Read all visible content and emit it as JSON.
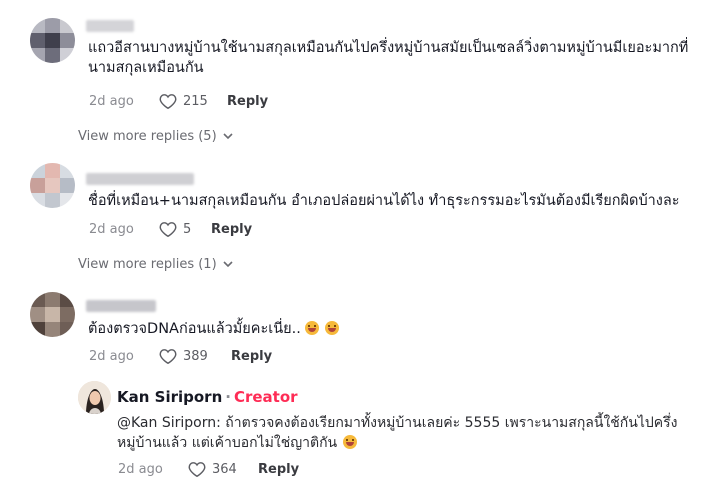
{
  "comments": [
    {
      "text_lines": [
        "แถวอีสานบางหมู่บ้านใช้นามสกุลเหมือนกันไปครึ่งหมู่บ้านสมัยเป็นเซลล์วิ่งตามหมู่บ้านมีเยอะมากที่",
        "นามสกุลเหมือนกัน"
      ],
      "time": "2d ago",
      "likes": "215",
      "reply_label": "Reply",
      "view_more": "View more replies (5)"
    },
    {
      "text_lines": [
        "ชื่อที่เหมือน+นามสกุลเหมือนกัน อำเภอปล่อยผ่านได้ไง ทำธุระกรรมอะไรมันต้องมีเรียกผิดบ้างละ"
      ],
      "time": "2d ago",
      "likes": "5",
      "reply_label": "Reply",
      "view_more": "View more replies (1)"
    },
    {
      "text_lines": [
        "ต้องตรวจDNAก่อนแล้วมั้ยคะเนี่ย.."
      ],
      "emojis": [
        "smiling-face",
        "smiling-face"
      ],
      "time": "2d ago",
      "likes": "389",
      "reply_label": "Reply"
    }
  ],
  "creator_reply": {
    "name": "Kan Siriporn",
    "separator": "·",
    "badge": "Creator",
    "text_lines": [
      "@Kan Siriporn: ถ้าตรวจคงต้องเรียกมาทั้งหมู่บ้านเลยค่ะ 5555 เพราะนามสกุลนี้ใช้กันไปครึ่ง",
      "หมู่บ้านแล้ว แต่เค้าบอกไม่ใช่ญาติกัน"
    ],
    "emoji": "laughing-face",
    "time": "2d ago",
    "likes": "364",
    "reply_label": "Reply"
  },
  "colors": {
    "creator_badge": "#fe2c55",
    "secondary_text": "#8a8b91"
  }
}
